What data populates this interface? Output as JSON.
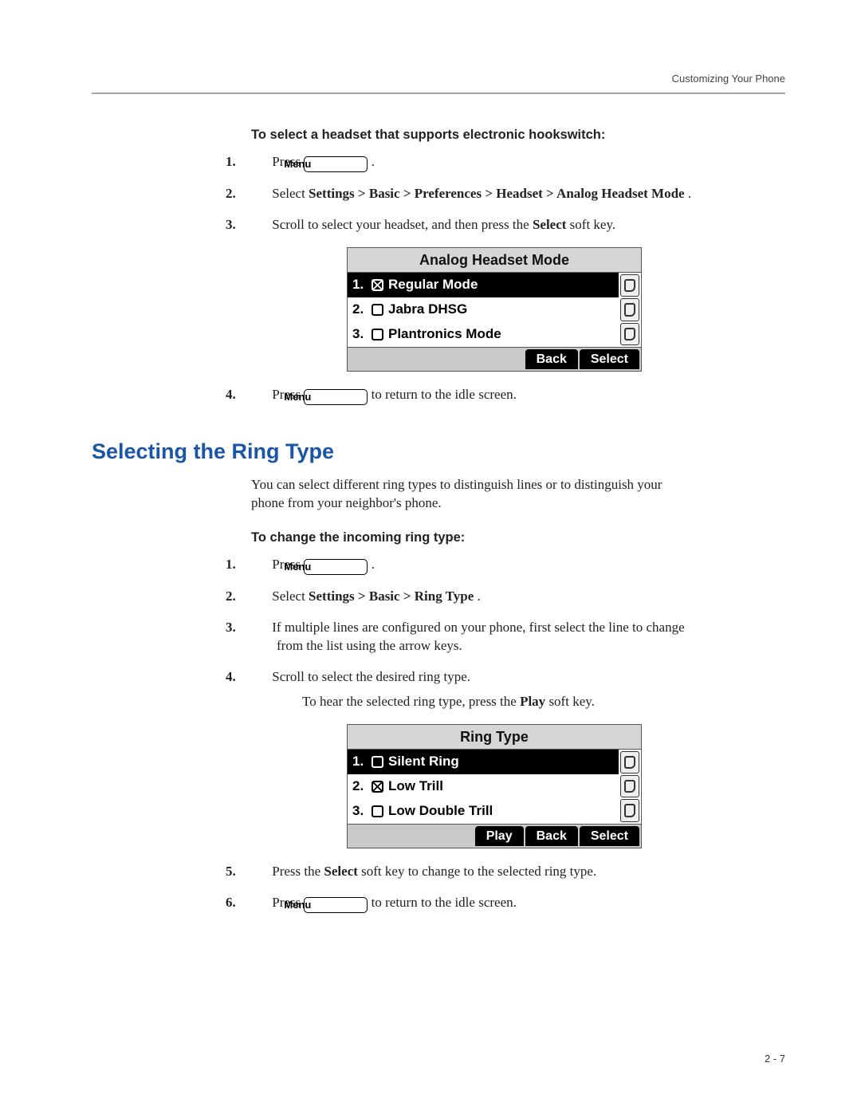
{
  "chapter_header": "Customizing Your Phone",
  "page_number": "2 - 7",
  "menu_button_label": "Menu",
  "section1": {
    "subhead": "To select a headset that supports electronic hookswitch:",
    "steps": {
      "s1_pre": "Press ",
      "s1_post": " .",
      "s2_pre": "Select ",
      "s2_bold": "Settings > Basic > Preferences > Headset > Analog Headset Mode",
      "s2_post": ".",
      "s3_pre": "Scroll to select your headset, and then press the ",
      "s3_bold": "Select",
      "s3_post": " soft key.",
      "s4_pre": "Press ",
      "s4_post": " to return to the idle screen."
    },
    "screen": {
      "title": "Analog Headset Mode",
      "items": [
        {
          "n": "1.",
          "checked": true,
          "selected": true,
          "label": "Regular Mode"
        },
        {
          "n": "2.",
          "checked": false,
          "selected": false,
          "label": "Jabra DHSG"
        },
        {
          "n": "3.",
          "checked": false,
          "selected": false,
          "label": "Plantronics Mode"
        }
      ],
      "softkeys": [
        "Back",
        "Select"
      ]
    }
  },
  "heading2": "Selecting the Ring Type",
  "intro_para": "You can select different ring types to distinguish lines or to distinguish your phone from your neighbor's phone.",
  "section2": {
    "subhead": "To change the incoming ring type:",
    "steps": {
      "s1_pre": "Press ",
      "s1_post": " .",
      "s2_pre": "Select ",
      "s2_bold": "Settings > Basic > Ring Type",
      "s2_post": ".",
      "s3": "If multiple lines are configured on your phone, first select the line to change from the list using the arrow keys.",
      "s4": "Scroll to select the desired ring type.",
      "s4b_pre": "To hear the selected ring type, press the ",
      "s4b_bold": "Play",
      "s4b_post": " soft key.",
      "s5_pre": "Press the ",
      "s5_bold": "Select",
      "s5_post": " soft key to change to the selected ring type.",
      "s6_pre": "Press ",
      "s6_post": " to return to the idle screen."
    },
    "screen": {
      "title": "Ring Type",
      "items": [
        {
          "n": "1.",
          "checked": false,
          "selected": true,
          "label": "Silent Ring"
        },
        {
          "n": "2.",
          "checked": true,
          "selected": false,
          "label": "Low Trill"
        },
        {
          "n": "3.",
          "checked": false,
          "selected": false,
          "label": "Low Double Trill"
        }
      ],
      "softkeys": [
        "Play",
        "Back",
        "Select"
      ]
    }
  }
}
